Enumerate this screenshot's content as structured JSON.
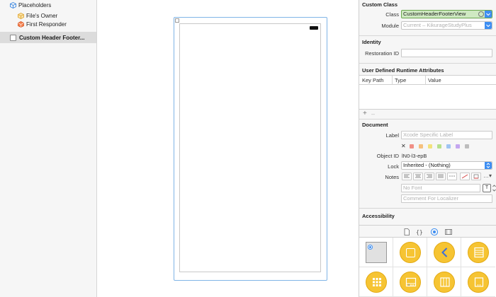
{
  "outline": {
    "placeholders_label": "Placeholders",
    "files_owner_label": "File's Owner",
    "first_responder_label": "First Responder",
    "selected_view_label": "Custom Header Footer..."
  },
  "inspector": {
    "custom_class": {
      "title": "Custom Class",
      "class_label": "Class",
      "class_value": "CustomHeaderFooterView",
      "module_label": "Module",
      "module_value": "Current – KikurageStudyPlus"
    },
    "identity": {
      "title": "Identity",
      "restoration_id_label": "Restoration ID",
      "restoration_id_value": ""
    },
    "runtime_attributes": {
      "title": "User Defined Runtime Attributes",
      "columns": [
        "Key Path",
        "Type",
        "Value"
      ],
      "add_symbol": "+",
      "remove_symbol": "–"
    },
    "document": {
      "title": "Document",
      "label_label": "Label",
      "label_placeholder": "Xcode Specific Label",
      "clear_color_symbol": "✕",
      "object_id_label": "Object ID",
      "object_id_value": "lN0-l3-epB",
      "lock_label": "Lock",
      "lock_value": "Inherited - (Nothing)",
      "notes_label": "Notes",
      "font_placeholder": "No Font",
      "comment_placeholder": "Comment For Localizer"
    },
    "accessibility": {
      "title": "Accessibility"
    }
  },
  "colors": {
    "accent": "#3d8ef2",
    "highlight_fill": "#cfe9c2",
    "highlight_border": "#6aa64d",
    "library_icon": "#f6c433",
    "swatches": [
      "#f08f86",
      "#f5c07d",
      "#f2e27c",
      "#b6e08d",
      "#9fc4f2",
      "#c4a6ef",
      "#bdbdbd"
    ]
  }
}
